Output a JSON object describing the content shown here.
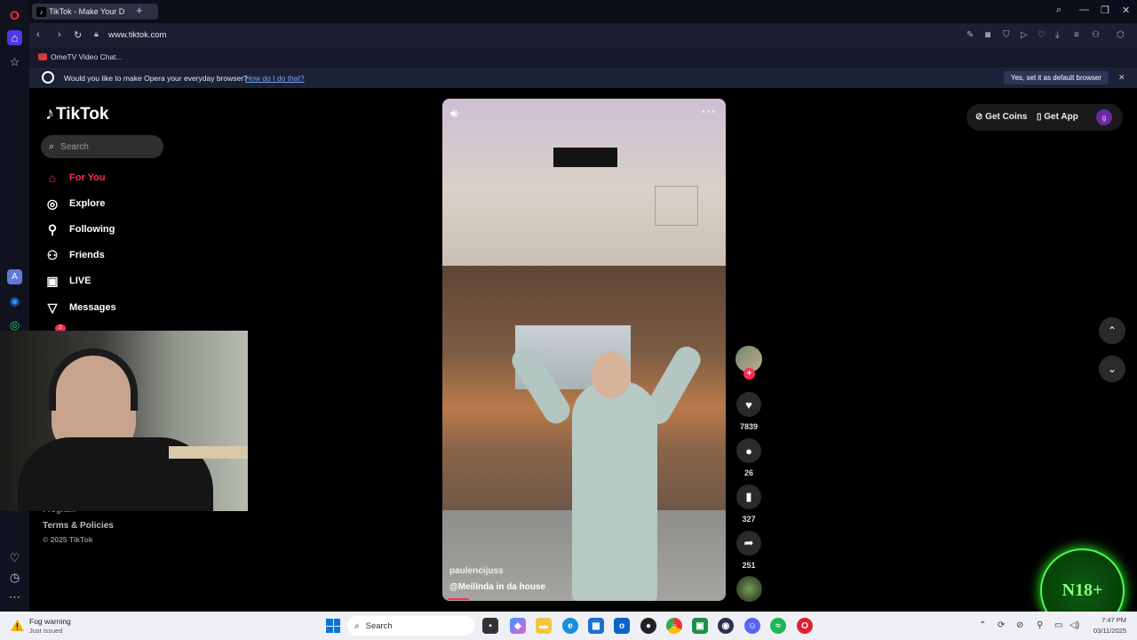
{
  "browser": {
    "tab_title": "TikTok - Make Your D",
    "tab_favicon": "tiktok-icon",
    "new_tab": "+",
    "url": "www.tiktok.com",
    "bookmark": "OmeTV Video Chat...",
    "infobar_text": "Would you like to make Opera your everyday browser?",
    "infobar_link": "How do I do that?",
    "infobar_button": "Yes, set it as default browser",
    "infobar_close": "✕"
  },
  "tiktok": {
    "logo": "TikTok",
    "search_placeholder": "Search",
    "nav": [
      {
        "label": "For You",
        "icon": "home-icon",
        "active": true
      },
      {
        "label": "Explore",
        "icon": "compass-icon",
        "active": false
      },
      {
        "label": "Following",
        "icon": "following-icon",
        "active": false
      },
      {
        "label": "Friends",
        "icon": "friends-icon",
        "active": false
      },
      {
        "label": "LIVE",
        "icon": "live-icon",
        "active": false
      },
      {
        "label": "Messages",
        "icon": "messages-icon",
        "active": false
      }
    ],
    "inbox_badge": "2",
    "footer": {
      "program": "Program",
      "terms": "Terms & Policies",
      "copyright": "© 2025 TikTok"
    },
    "top_right": {
      "get_coins": "Get Coins",
      "get_app": "Get App",
      "profile_initial": "g"
    },
    "video": {
      "author": "paulencijuss",
      "caption": "@Meilinda in da house",
      "more": "···"
    },
    "actions": {
      "likes": "7839",
      "comments": "26",
      "saves": "327",
      "shares": "251",
      "follow": "+"
    }
  },
  "overlay": {
    "badge": "N18+"
  },
  "taskbar": {
    "weather_title": "Fog warning",
    "weather_sub": "Just issued",
    "search": "Search",
    "time": "7:47 PM",
    "date": "03/11/2025"
  }
}
